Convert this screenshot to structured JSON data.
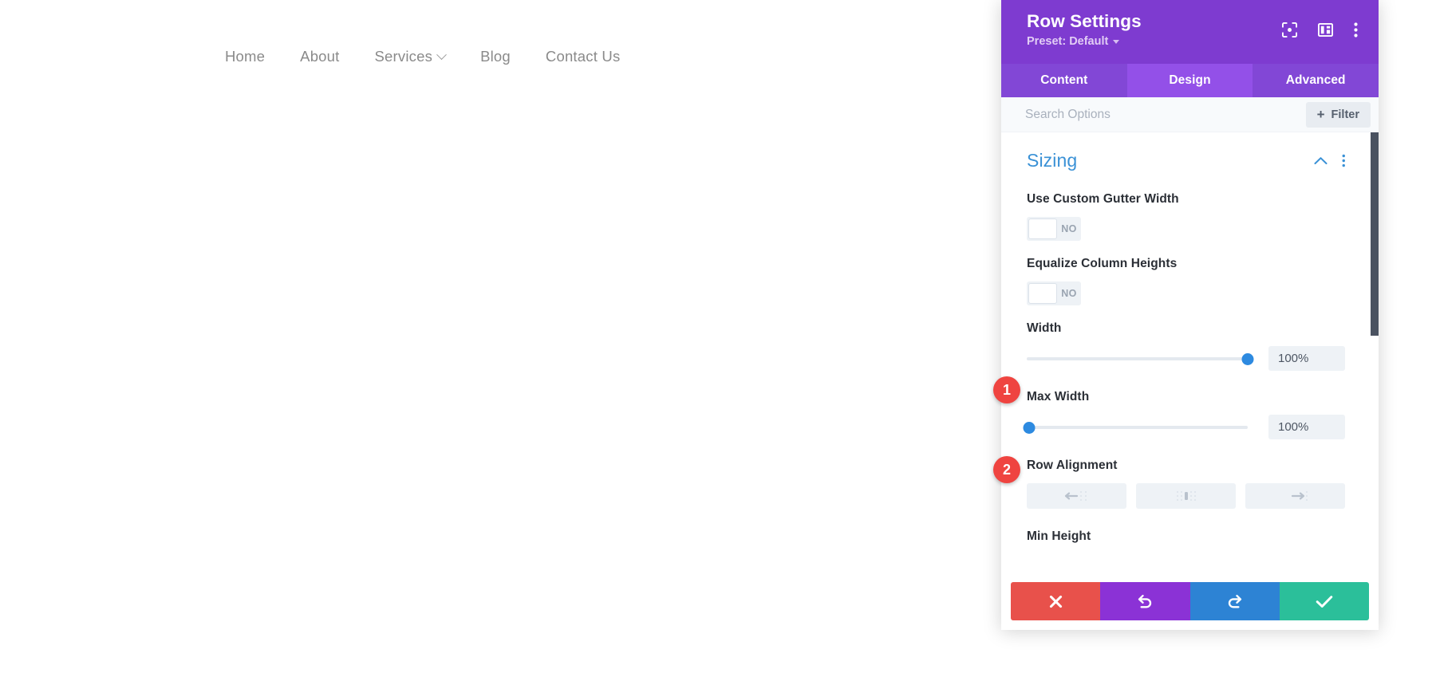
{
  "site": {
    "nav": [
      {
        "label": "Home",
        "has_dropdown": false
      },
      {
        "label": "About",
        "has_dropdown": false
      },
      {
        "label": "Services",
        "has_dropdown": true
      },
      {
        "label": "Blog",
        "has_dropdown": false
      },
      {
        "label": "Contact Us",
        "has_dropdown": false
      }
    ]
  },
  "panel": {
    "title": "Row Settings",
    "preset_label": "Preset: Default",
    "header_icons": [
      {
        "name": "focus-target-icon"
      },
      {
        "name": "layout-panel-icon"
      },
      {
        "name": "more-vertical-icon"
      }
    ],
    "tabs": [
      {
        "label": "Content",
        "active": false
      },
      {
        "label": "Design",
        "active": true
      },
      {
        "label": "Advanced",
        "active": false
      }
    ],
    "search": {
      "value": "",
      "placeholder": "Search Options"
    },
    "filter_button": {
      "label": "Filter",
      "plus": "+"
    },
    "section": {
      "title": "Sizing",
      "collapse_icon": "chevron-up-icon",
      "menu_icon": "more-vertical-icon"
    },
    "fields": {
      "use_custom_gutter_width": {
        "label": "Use Custom Gutter Width",
        "toggle_value": "NO"
      },
      "equalize_column_heights": {
        "label": "Equalize Column Heights",
        "toggle_value": "NO"
      },
      "width": {
        "label": "Width",
        "value": "100%",
        "slider_percent": 100
      },
      "max_width": {
        "label": "Max Width",
        "value": "100%",
        "slider_percent": 1
      },
      "row_alignment": {
        "label": "Row Alignment",
        "options": [
          {
            "name": "align-left",
            "icon": "arrow-left-icon"
          },
          {
            "name": "align-center",
            "icon": "align-center-icon"
          },
          {
            "name": "align-right",
            "icon": "arrow-right-icon"
          }
        ]
      },
      "min_height": {
        "label": "Min Height"
      }
    },
    "actions": [
      {
        "name": "cancel",
        "icon": "close-x-icon",
        "color": "#e8514b"
      },
      {
        "name": "undo",
        "icon": "undo-arrow-icon",
        "color": "#8b32d6"
      },
      {
        "name": "redo",
        "icon": "redo-arrow-icon",
        "color": "#2d83d4"
      },
      {
        "name": "save",
        "icon": "checkmark-icon",
        "color": "#2bbf9a"
      }
    ]
  },
  "annotations": {
    "badges": [
      {
        "number": "1",
        "target": "width-slider"
      },
      {
        "number": "2",
        "target": "max-width-slider"
      }
    ]
  },
  "colors": {
    "header_purple": "#7e3bd0",
    "tabbar_purple": "#8247d6",
    "tab_active_purple": "#9350e8",
    "section_title_blue": "#3a91d6",
    "slider_blue": "#2d8ae0",
    "badge_red": "#ef4440"
  }
}
